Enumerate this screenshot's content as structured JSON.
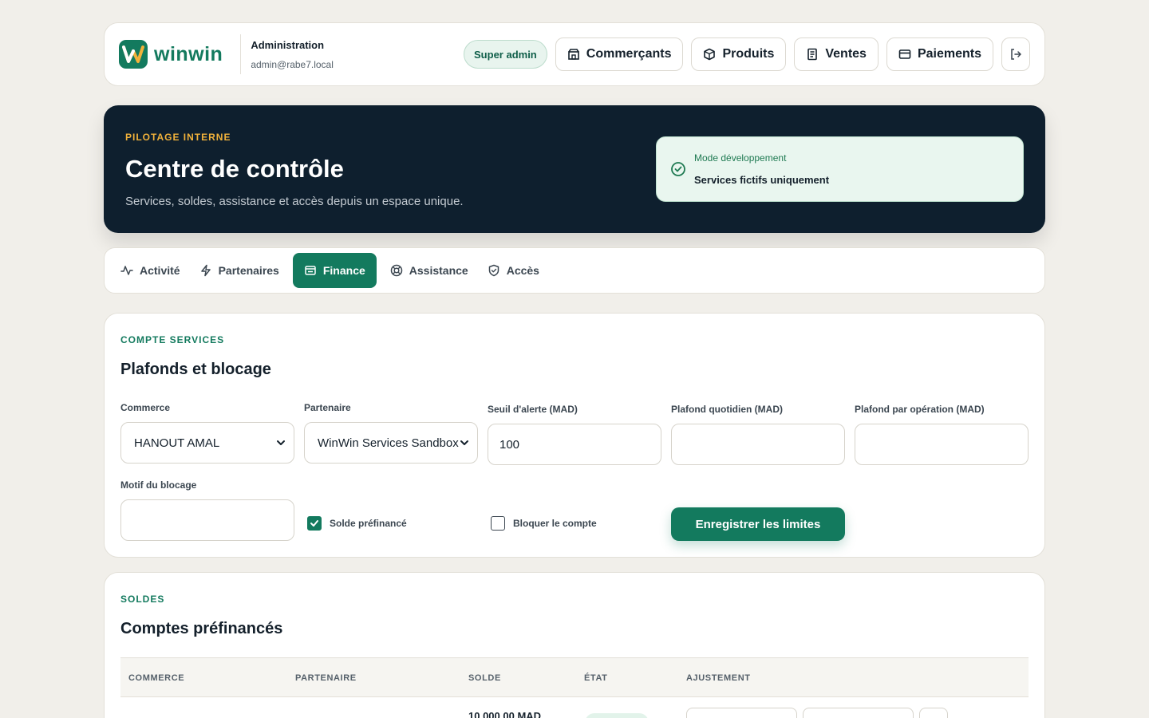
{
  "brand": {
    "name": "winwin",
    "color": "#137a5e"
  },
  "header": {
    "title": "Administration",
    "email": "admin@rabe7.local",
    "role_badge": "Super admin",
    "nav": [
      {
        "label": "Commerçants",
        "icon": "store-icon"
      },
      {
        "label": "Produits",
        "icon": "package-icon"
      },
      {
        "label": "Ventes",
        "icon": "receipt-icon"
      },
      {
        "label": "Paiements",
        "icon": "credit-card-icon"
      }
    ],
    "logout_icon": "logout-icon"
  },
  "hero": {
    "eyebrow": "PILOTAGE INTERNE",
    "title": "Centre de contrôle",
    "subtitle": "Services, soldes, assistance et accès depuis un espace unique.",
    "mode_label": "Mode développement",
    "mode_value": "Services fictifs uniquement"
  },
  "tabs": [
    {
      "label": "Activité",
      "icon": "activity-icon",
      "active": false
    },
    {
      "label": "Partenaires",
      "icon": "zap-icon",
      "active": false
    },
    {
      "label": "Finance",
      "icon": "wallet-icon",
      "active": true
    },
    {
      "label": "Assistance",
      "icon": "lifebuoy-icon",
      "active": false
    },
    {
      "label": "Accès",
      "icon": "shield-icon",
      "active": false
    }
  ],
  "limits": {
    "eyebrow": "COMPTE SERVICES",
    "title": "Plafonds et blocage",
    "commerce_label": "Commerce",
    "commerce_value": "HANOUT AMAL",
    "partner_label": "Partenaire",
    "partner_value": "WinWin Services Sandbox",
    "alert_label": "Seuil d'alerte (MAD)",
    "alert_value": "100",
    "daily_label": "Plafond quotidien (MAD)",
    "daily_value": "",
    "per_op_label": "Plafond par opération (MAD)",
    "per_op_value": "",
    "reason_label": "Motif du blocage",
    "reason_value": "",
    "prefunded_label": "Solde préfinancé",
    "prefunded_checked": true,
    "block_label": "Bloquer le compte",
    "block_checked": false,
    "save_label": "Enregistrer les limites"
  },
  "balances": {
    "eyebrow": "SOLDES",
    "title": "Comptes préfinancés",
    "columns": [
      "COMMERCE",
      "PARTENAIRE",
      "SOLDE",
      "ÉTAT",
      "AJUSTEMENT"
    ],
    "rows": [
      {
        "solde": "10 000,00 MAD"
      }
    ]
  }
}
